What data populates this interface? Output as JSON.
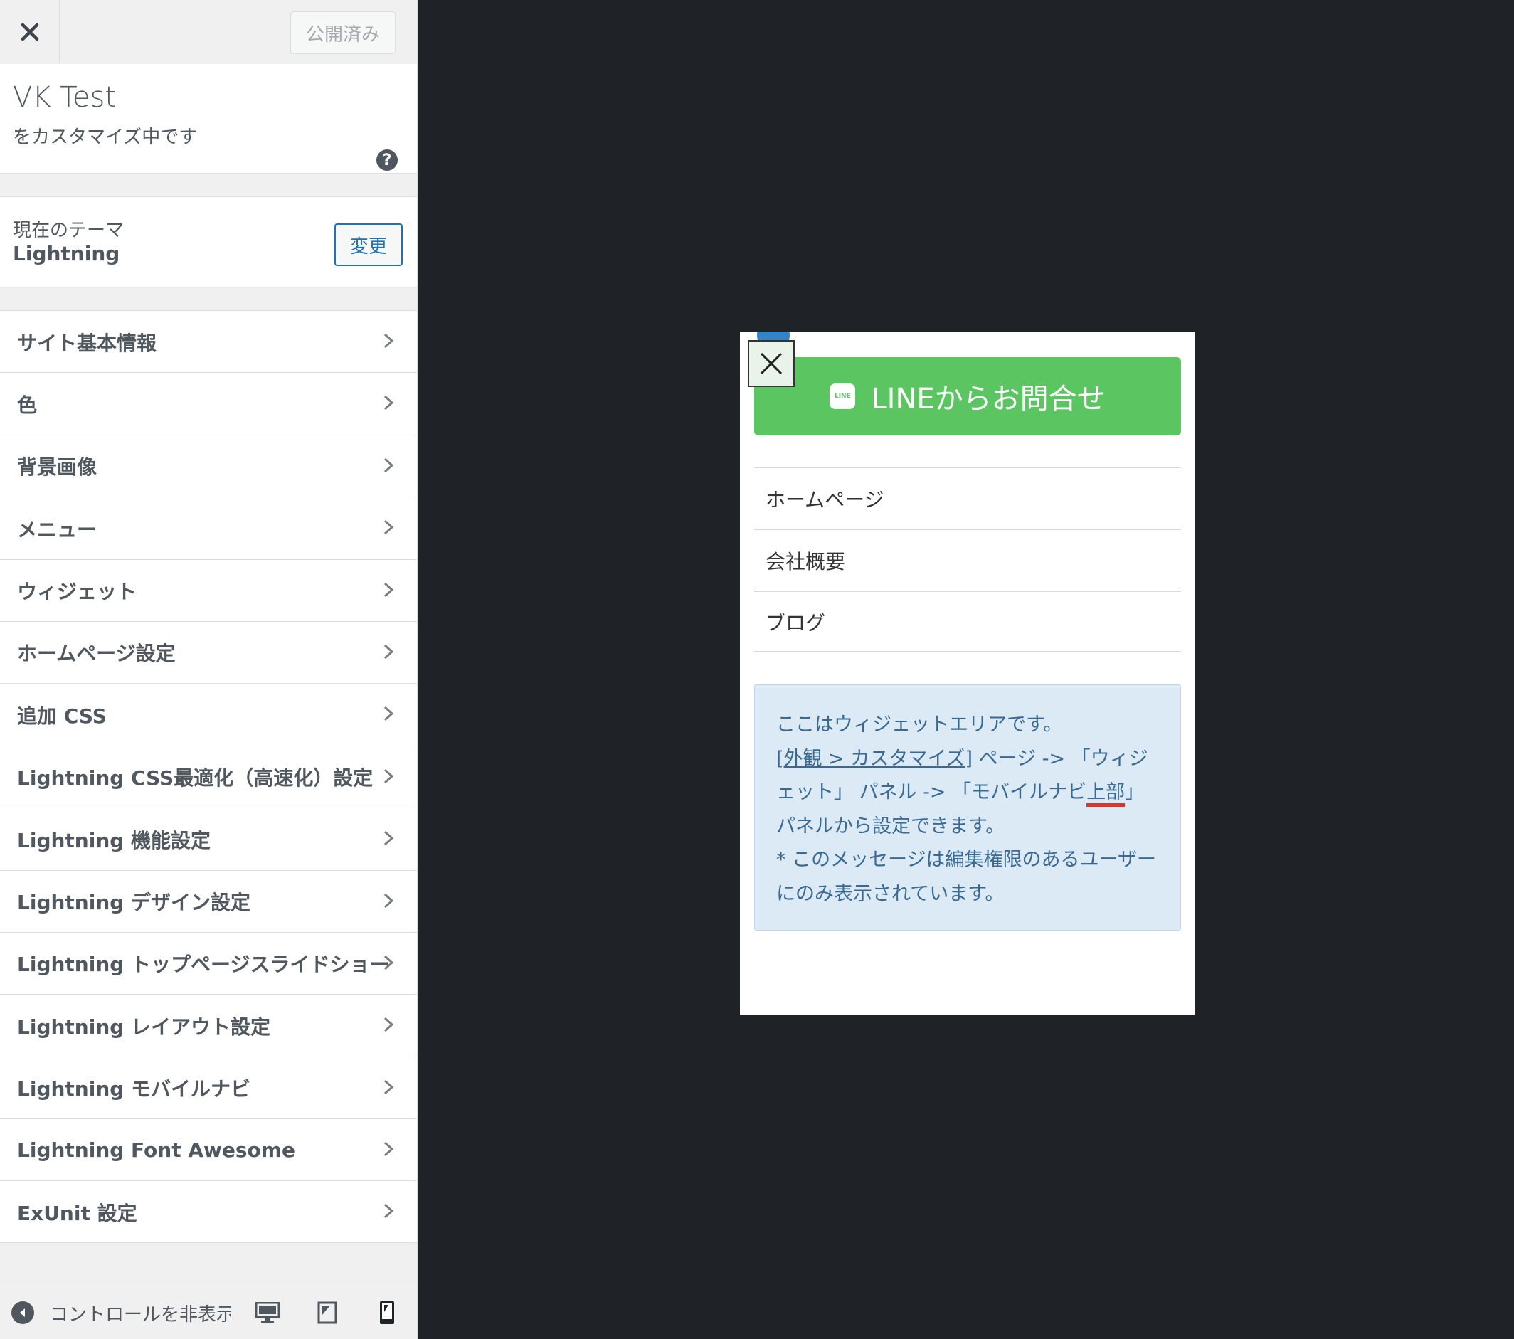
{
  "header": {
    "close_label": "×",
    "publish_label": "公開済み"
  },
  "site": {
    "title": "VK Test",
    "subtitle": "をカスタマイズ中です",
    "help_icon": "question-circle-icon"
  },
  "theme": {
    "label": "現在のテーマ",
    "name": "Lightning",
    "change_label": "変更"
  },
  "panels": [
    {
      "label": "サイト基本情報"
    },
    {
      "label": "色"
    },
    {
      "label": "背景画像"
    },
    {
      "label": "メニュー"
    },
    {
      "label": "ウィジェット"
    },
    {
      "label": "ホームページ設定"
    },
    {
      "label": "追加 CSS"
    },
    {
      "label": "Lightning CSS最適化（高速化）設定"
    },
    {
      "label": "Lightning 機能設定"
    },
    {
      "label": "Lightning デザイン設定"
    },
    {
      "label": "Lightning トップページスライドショー"
    },
    {
      "label": "Lightning レイアウト設定"
    },
    {
      "label": "Lightning モバイルナビ"
    },
    {
      "label": "Lightning Font Awesome"
    },
    {
      "label": "ExUnit 設定"
    }
  ],
  "footer": {
    "collapse_label": "コントロールを非表示",
    "devices": [
      "desktop-icon",
      "tablet-icon",
      "mobile-icon"
    ]
  },
  "preview": {
    "line_button": "LINEからお問合せ",
    "line_icon_text": "LINE",
    "nav_items": [
      "ホームページ",
      "会社概要",
      "ブログ"
    ],
    "notice": {
      "line1": "ここはウィジェットエリアです。",
      "bracket_open": "[",
      "link": "外観 > カスタマイズ",
      "bracket_close": "]",
      "part2": " ページ -> 「ウィジェット」 パネル -> 「モバイルナビ",
      "highlight": "上部",
      "part3": "」パネルから設定できます。",
      "line3": "* このメッセージは編集権限のあるユーザーにのみ表示されています。"
    }
  },
  "colors": {
    "accent": "#2271b1",
    "line_green": "#5bc561",
    "preview_bg": "#1f2327",
    "notice_bg": "#dbeaf5"
  }
}
